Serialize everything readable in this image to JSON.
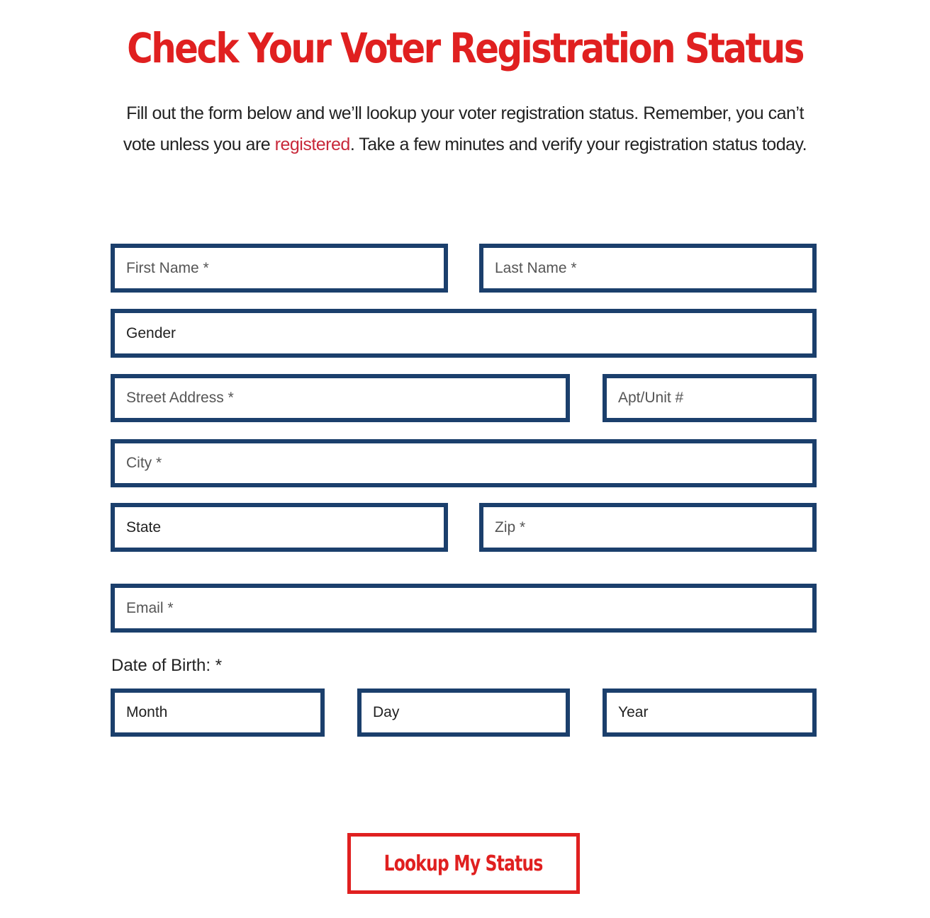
{
  "page": {
    "title": "Check Your Voter Registration Status",
    "intro_before": "Fill out the form below and we’ll lookup your voter registration status. Remember, you can’t vote unless you are ",
    "intro_link": "registered",
    "intro_after": ". Take a few minutes and verify your registration status today."
  },
  "form": {
    "first_name": "First Name *",
    "last_name": "Last Name *",
    "gender": "Gender",
    "street": "Street Address *",
    "apt": "Apt/Unit #",
    "city": "City *",
    "state": "State",
    "zip": "Zip *",
    "email": "Email *",
    "dob_label": "Date of Birth: *",
    "month": "Month",
    "day": "Day",
    "year": "Year",
    "submit": "Lookup My Status"
  },
  "colors": {
    "accent_red": "#e02020",
    "link_red": "#c8283a",
    "border_navy": "#1b3f6c"
  }
}
